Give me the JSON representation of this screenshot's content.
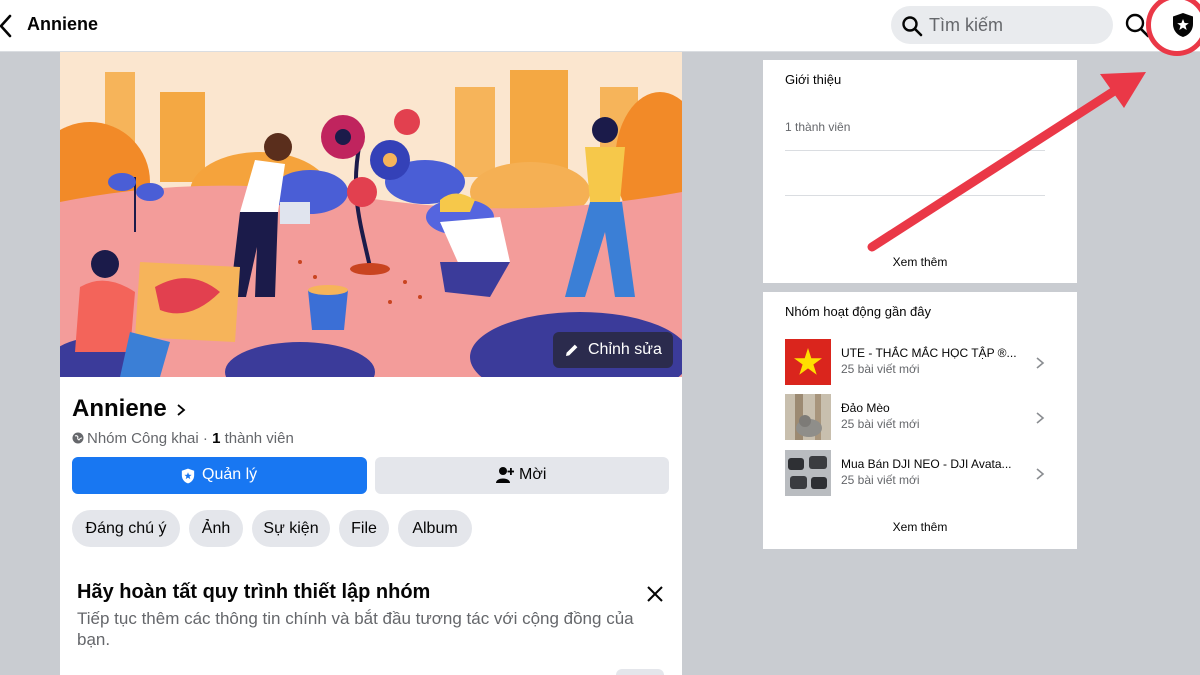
{
  "header": {
    "title": "Anniene",
    "search_placeholder": "Tìm kiếm",
    "icons": [
      "back-chevron-icon",
      "search-icon",
      "admin-shield-icon"
    ],
    "highlight_color": "#ea3847"
  },
  "cover": {
    "edit_label": "Chỉnh sửa"
  },
  "group": {
    "name": "Anniene",
    "privacy": "Nhóm Công khai",
    "separator": " · ",
    "member_count": "1",
    "member_label": " thành viên"
  },
  "actions": {
    "manage_label": "Quản lý",
    "invite_label": "Mời",
    "accent_color": "#1877f2"
  },
  "tabs": [
    {
      "label": "Đáng chú ý"
    },
    {
      "label": "Ảnh"
    },
    {
      "label": "Sự kiện"
    },
    {
      "label": "File"
    },
    {
      "label": "Album"
    }
  ],
  "setup": {
    "title": "Hãy hoàn tất quy trình thiết lập nhóm",
    "description": "Tiếp tục thêm các thông tin chính và bắt đầu tương tác với cộng đồng của bạn."
  },
  "about": {
    "title": "Giới thiệu",
    "members": "1 thành viên",
    "see_more": "Xem thêm"
  },
  "recent_groups": {
    "title": "Nhóm hoạt động gần đây",
    "items": [
      {
        "name": "UTE - THẮC MẮC HỌC TẬP ®...",
        "sub": "25 bài viết mới"
      },
      {
        "name": "Đảo Mèo",
        "sub": "25 bài viết mới"
      },
      {
        "name": "Mua Bán DJI NEO - DJI Avata...",
        "sub": "25 bài viết mới"
      }
    ],
    "see_more": "Xem thêm"
  }
}
